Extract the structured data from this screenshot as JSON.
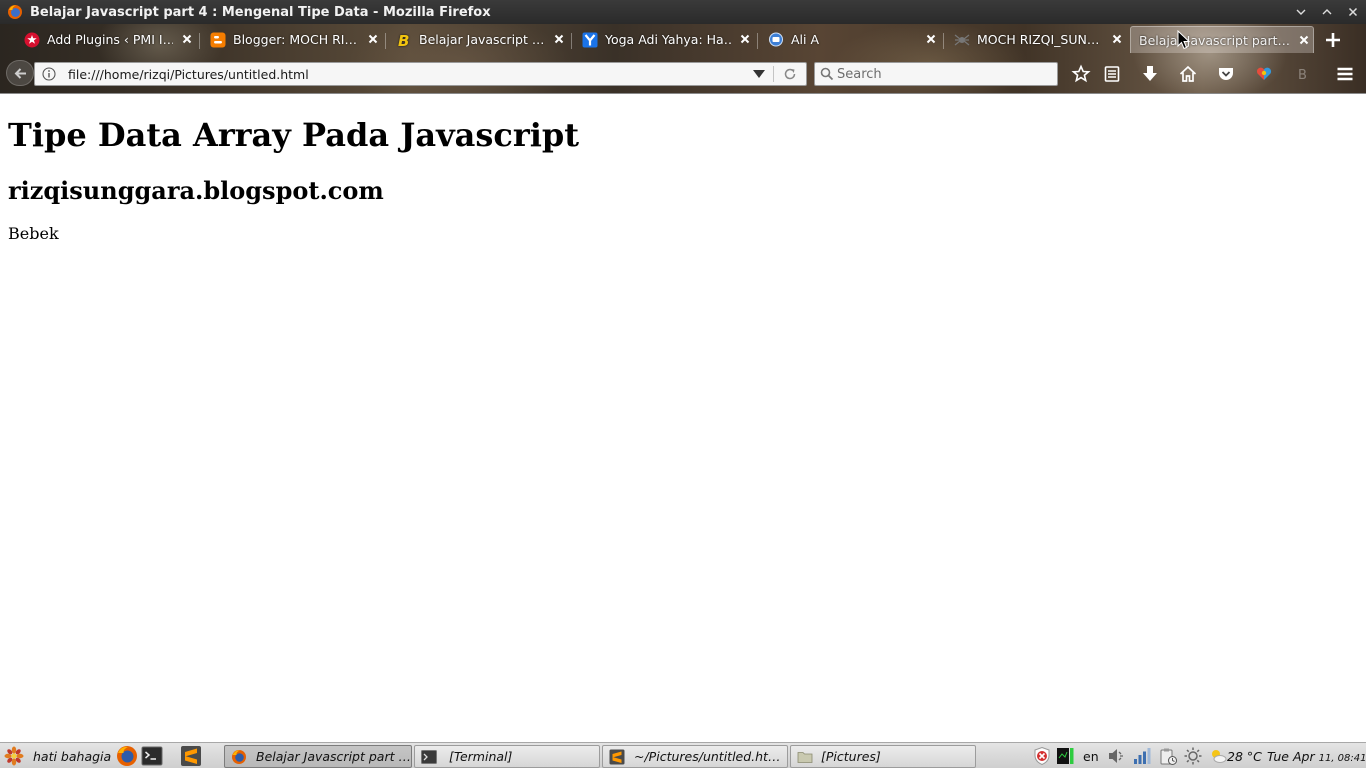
{
  "window": {
    "title": "Belajar Javascript part 4 : Mengenal Tipe Data - Mozilla Firefox"
  },
  "tabs": [
    {
      "label": "Add Plugins ‹ PMI I…",
      "icon": "wordpress-flower-icon",
      "active": false
    },
    {
      "label": "Blogger: MOCH RI…",
      "icon": "blogger-icon",
      "active": false
    },
    {
      "label": "Belajar Javascript …",
      "icon": "b-logo-icon",
      "active": false
    },
    {
      "label": "Yoga Adi Yahya: Ha…",
      "icon": "y-logo-icon",
      "active": false
    },
    {
      "label": "Ali A",
      "icon": "chat-bubble-icon",
      "active": false
    },
    {
      "label": "MOCH RIZQI_SUN…",
      "icon": "spider-icon",
      "active": false
    },
    {
      "label": "Belajar Javascript part…",
      "icon": "none",
      "active": true
    }
  ],
  "navbar": {
    "url": "file:///home/rizqi/Pictures/untitled.html",
    "search_placeholder": "Search"
  },
  "page": {
    "heading": "Tipe Data Array Pada Javascript",
    "subheading": "rizqisunggara.blogspot.com",
    "text": "Bebek"
  },
  "taskbar": {
    "start_label": "hati bahagia",
    "tasks": [
      {
        "label": "Belajar Javascript part …",
        "icon": "firefox-icon",
        "active": true
      },
      {
        "label": "[Terminal]",
        "icon": "terminal-icon",
        "active": false
      },
      {
        "label": "~/Pictures/untitled.htm…",
        "icon": "sublime-text-icon",
        "active": false
      },
      {
        "label": "[Pictures]",
        "icon": "folder-icon",
        "active": false
      }
    ],
    "tray": {
      "keyboard_layout": "en",
      "temperature": "28 °C",
      "clock_date": "Tue Apr",
      "clock_time": "11, 08:41"
    }
  },
  "colors": {
    "titlebar_bg": "#2d2d2d",
    "taskbar_bg": "#d8d8d8",
    "page_bg": "#ffffff"
  }
}
